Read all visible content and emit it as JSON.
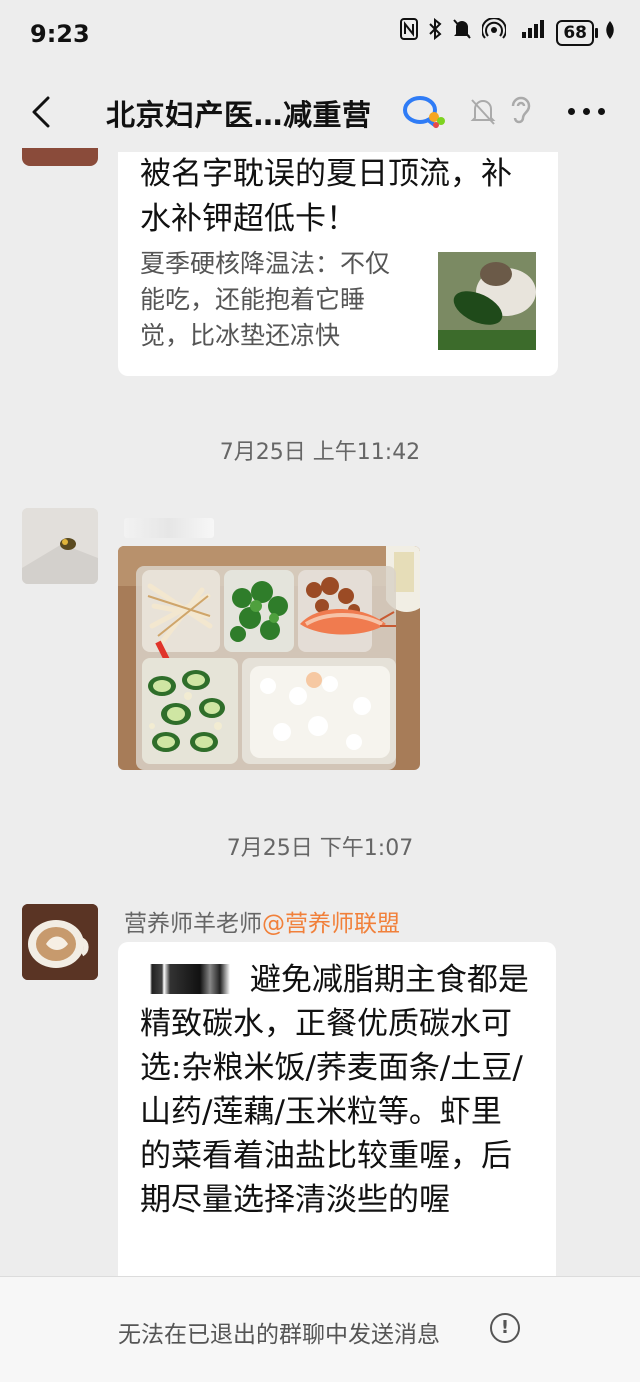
{
  "status_bar": {
    "time": "9:23",
    "battery": "68",
    "icons": [
      "nfc-icon",
      "bluetooth-icon",
      "mute-icon",
      "hotspot-icon",
      "signal-icon",
      "battery-icon",
      "leaf-icon"
    ]
  },
  "header": {
    "title": "北京妇产医…减重营",
    "icons": [
      "back-icon",
      "group-badge-icon",
      "bell-off-icon",
      "ear-icon",
      "more-icon"
    ]
  },
  "messages": {
    "article": {
      "title": "被名字耽误的夏日顶流，补水补钾超低卡！",
      "desc": "夏季硬核降温法：不仅能吃，还能抱着它睡觉，比冰垫还凉快"
    },
    "stamp1": "7月25日 上午11:42",
    "stamp2": "7月25日 下午1:07",
    "reply": {
      "sender_name": "营养师羊老师",
      "sender_org": "@营养师联盟",
      "text": "避免减脂期主食都是精致碳水，正餐优质碳水可选:杂粮米饭/荞麦面条/土豆/山药/莲藕/玉米粒等。虾里的菜看着油盐比较重喔，后期尽量选择清淡些的喔"
    }
  },
  "footer": {
    "notice": "无法在已退出的群聊中发送消息"
  },
  "colors": {
    "background": "#ededed",
    "bubble": "#ffffff",
    "org_tag": "#f1803a"
  }
}
